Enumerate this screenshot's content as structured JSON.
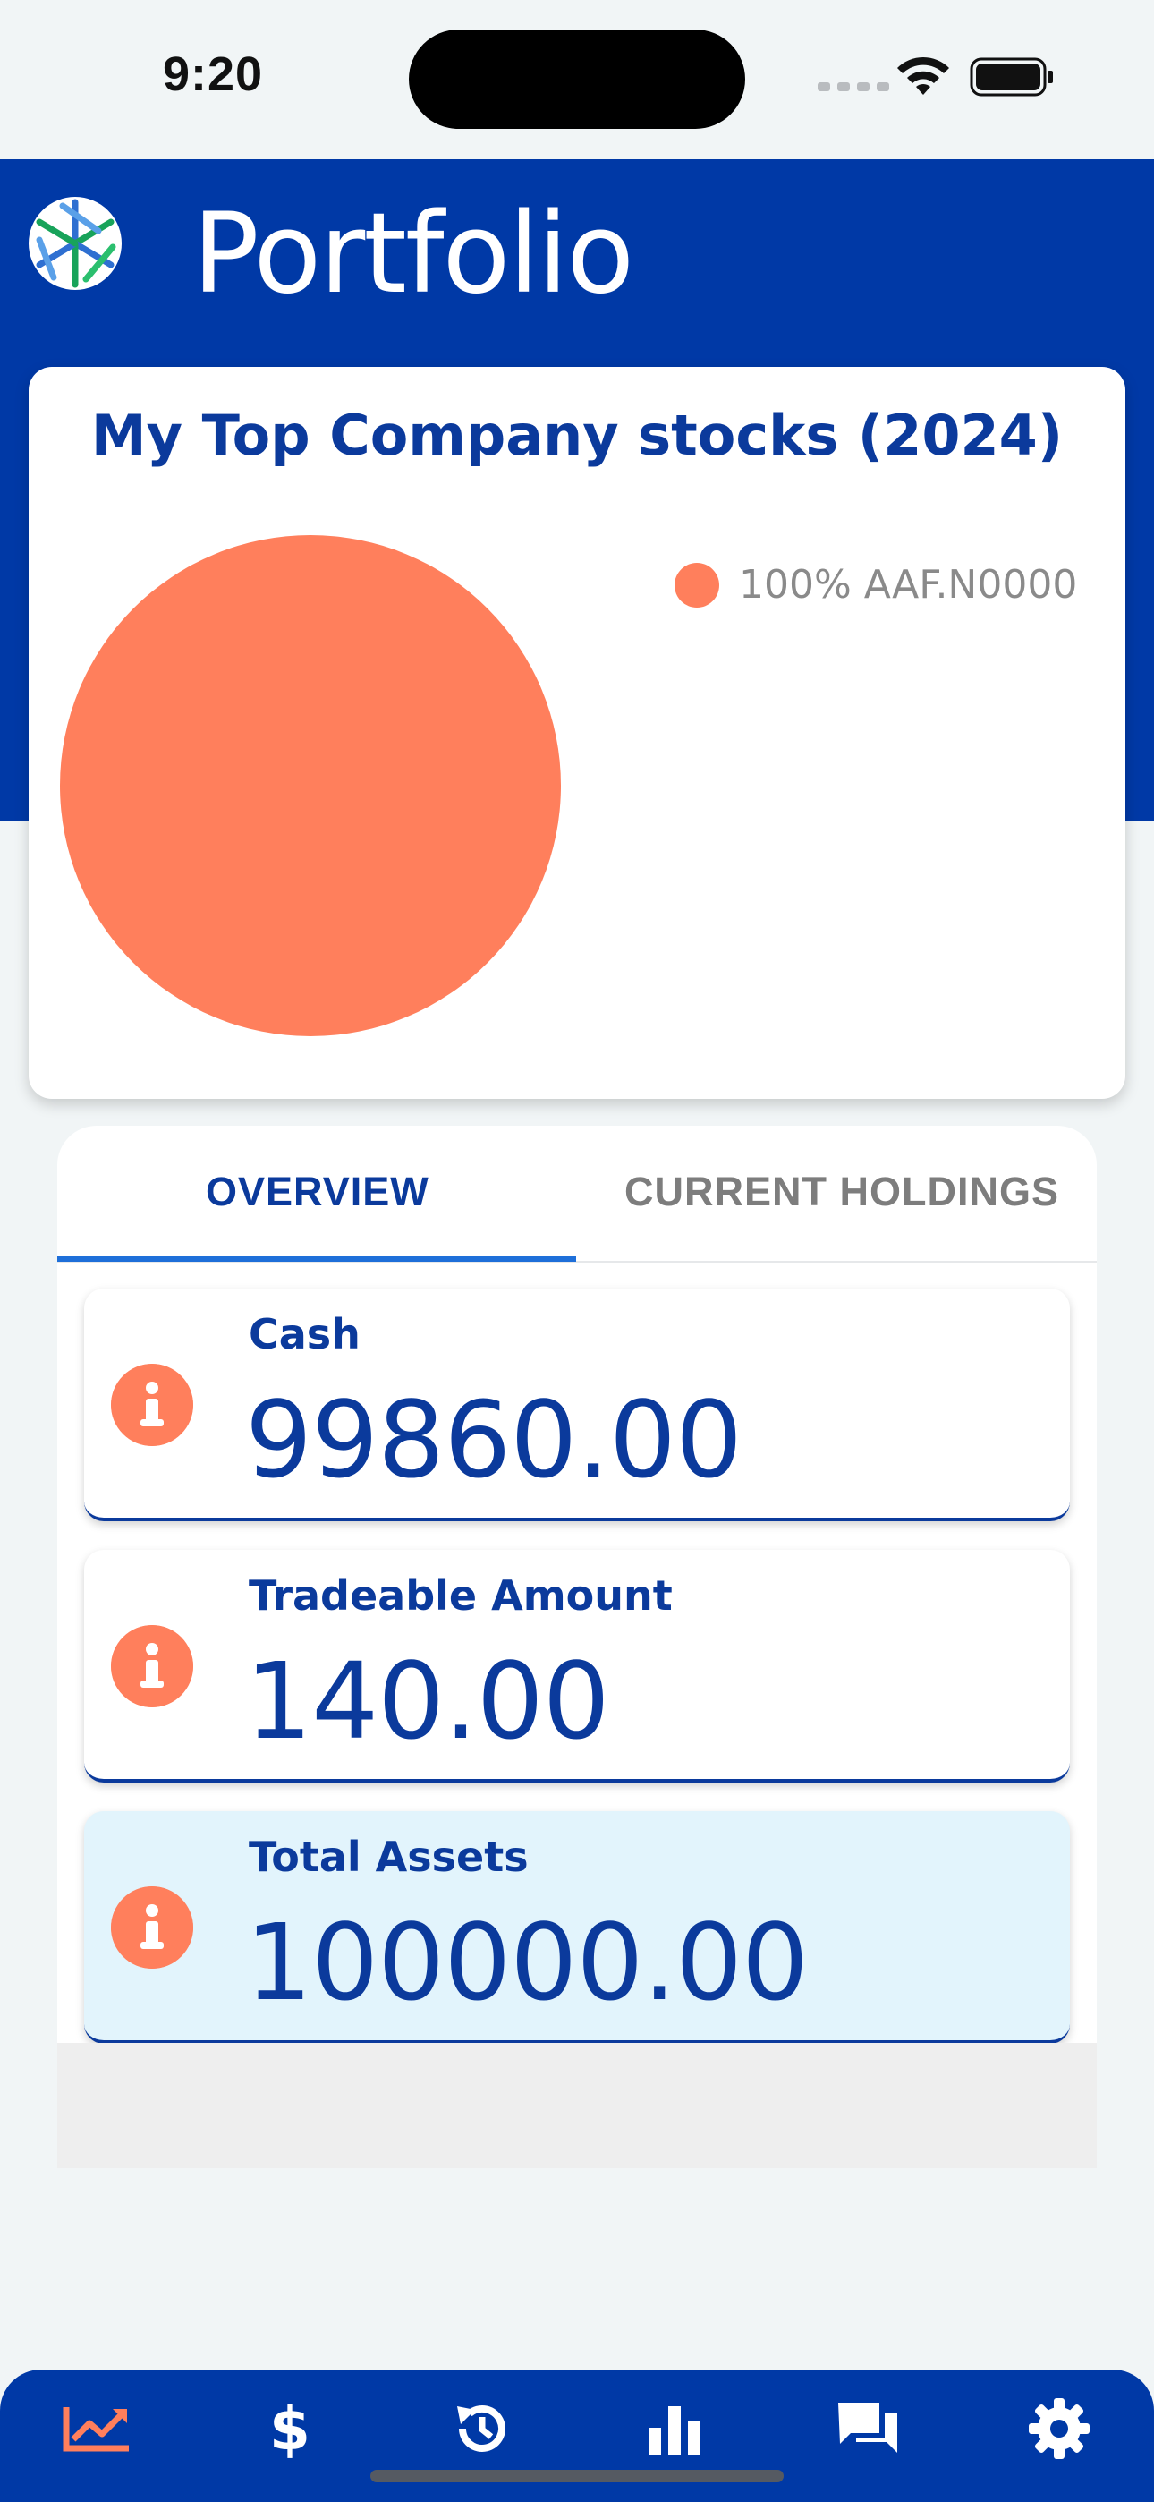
{
  "status_bar": {
    "time": "9:20"
  },
  "header": {
    "title": "Portfolio",
    "logo_icon": "company-logo-icon"
  },
  "chart_card": {
    "title": "My Top Company stocks (2024)"
  },
  "chart_data": {
    "type": "pie",
    "title": "My Top Company stocks (2024)",
    "slices": [
      {
        "label": "AAF.N0000",
        "value": 100,
        "color": "#ff7f5c"
      }
    ],
    "legend": [
      {
        "label": "100% AAF.N0000",
        "color": "#ff7f5c"
      }
    ],
    "legend_placement": "top-right"
  },
  "tabs": [
    {
      "label": "OVERVIEW",
      "active": true
    },
    {
      "label": "CURRENT HOLDINGS",
      "active": false
    }
  ],
  "stats": [
    {
      "label": "Cash",
      "value": "99860.00",
      "icon": "info-icon"
    },
    {
      "label": "Tradeable Amount",
      "value": "140.00",
      "icon": "info-icon"
    },
    {
      "label": "Total Assets",
      "value": "100000.00",
      "icon": "info-icon"
    }
  ],
  "bottom_nav": [
    {
      "name": "portfolio",
      "icon": "trending-up-icon",
      "active": true
    },
    {
      "name": "trade",
      "icon": "dollar-icon",
      "active": false
    },
    {
      "name": "history",
      "icon": "history-icon",
      "active": false
    },
    {
      "name": "market",
      "icon": "bar-chart-icon",
      "active": false
    },
    {
      "name": "messages",
      "icon": "chat-icon",
      "active": false
    },
    {
      "name": "settings",
      "icon": "gear-icon",
      "active": false
    }
  ],
  "colors": {
    "brand_blue": "#0039a6",
    "text_blue": "#0b3a9c",
    "accent_orange": "#ff7f5c",
    "tab_underline": "#1e6fd9",
    "highlight_card": "#e2f4fc"
  }
}
